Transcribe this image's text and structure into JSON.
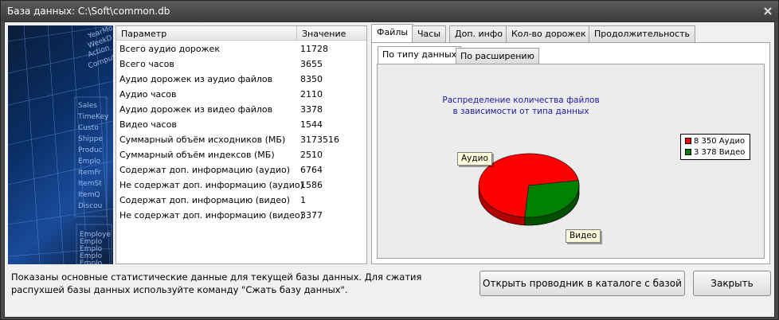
{
  "window": {
    "title": "База данных: C:\\Soft\\common.db"
  },
  "sidebar_image_text": [
    "Sales",
    "TimeKey",
    "Custo",
    "Shippe",
    "Produc",
    "Emplo",
    "ItemFr",
    "ItemSt",
    "ItemQ",
    "Discou",
    "Employe",
    "Emplo",
    "Emplo",
    "Emplo",
    "Emplo",
    "YearMo",
    "WeekD",
    "Action",
    "Compute"
  ],
  "stats_table": {
    "columns": [
      "Параметр",
      "Значение"
    ],
    "rows": [
      [
        "Всего аудио дорожек",
        "11728"
      ],
      [
        "Всего часов",
        "3655"
      ],
      [
        "Аудио дорожек из аудио файлов",
        "8350"
      ],
      [
        "Аудио часов",
        "2110"
      ],
      [
        "Аудио дорожек из видео файлов",
        "3378"
      ],
      [
        "Видео часов",
        "1544"
      ],
      [
        "Суммарный объём исходников (МБ)",
        "3173516"
      ],
      [
        "Суммарный объём индексов  (МБ)",
        "2510"
      ],
      [
        "Содержат доп. информацию (аудио)",
        "6764"
      ],
      [
        "Не содержат доп. информацию (аудио)",
        "1586"
      ],
      [
        "Содержат доп. информацию (видео)",
        "1"
      ],
      [
        "Не содержат доп. информацию (видео)",
        "3377"
      ]
    ]
  },
  "tabs": [
    "Файлы",
    "Часы",
    "Доп. инфо",
    "Кол-во дорожек",
    "Продолжительность"
  ],
  "active_tab": "Файлы",
  "subtabs": [
    "По типу данных",
    "По расширению"
  ],
  "active_subtab": "По типу данных",
  "chart": {
    "title_line1": "Распределение количества файлов",
    "title_line2": "в зависимости от типа данных",
    "legend": [
      "8 350 Аудио",
      "3 378 Видео"
    ],
    "label_audio": "Аудио",
    "label_video": "Видео",
    "colors": {
      "audio": "#ff0000",
      "video": "#008000"
    }
  },
  "chart_data": {
    "type": "pie",
    "title": "Распределение количества файлов в зависимости от типа данных",
    "categories": [
      "Аудио",
      "Видео"
    ],
    "values": [
      8350,
      3378
    ],
    "legend_entries": [
      "8 350 Аудио",
      "3 378 Видео"
    ],
    "legend_placement": "top-right",
    "colors": [
      "#ff0000",
      "#008000"
    ],
    "style": "3d"
  },
  "footer": {
    "info": "Показаны основные статистические данные для текущей базы данных. Для сжатия распухшей базы данных используйте команду \"Сжать базу данных\".",
    "open_explorer_button": "Открыть проводник в каталоге с базой",
    "close_button": "Закрыть"
  }
}
